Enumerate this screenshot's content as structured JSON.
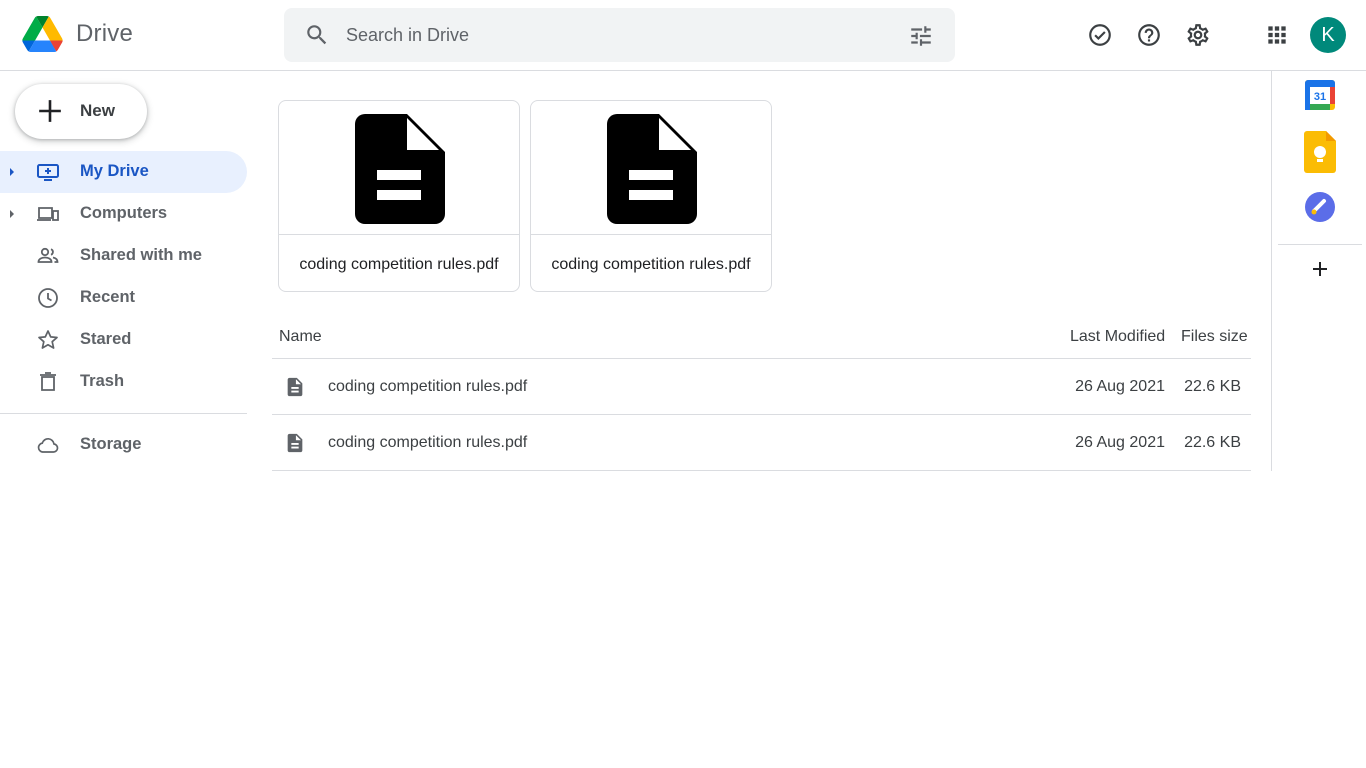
{
  "header": {
    "app_title": "Drive",
    "search_placeholder": "Search in Drive",
    "avatar_initial": "K",
    "icons": [
      "ready-for-offline-icon",
      "help-icon",
      "settings-icon",
      "apps-grid-icon"
    ]
  },
  "sidebar": {
    "new_label": "New",
    "items": [
      {
        "label": "My Drive",
        "icon": "my-drive-icon",
        "active": true,
        "expandable": true
      },
      {
        "label": "Computers",
        "icon": "computers-icon",
        "active": false,
        "expandable": true
      },
      {
        "label": "Shared with me",
        "icon": "shared-icon",
        "active": false,
        "expandable": false
      },
      {
        "label": "Recent",
        "icon": "clock-icon",
        "active": false,
        "expandable": false
      },
      {
        "label": "Stared",
        "icon": "star-icon",
        "active": false,
        "expandable": false
      },
      {
        "label": "Trash",
        "icon": "trash-icon",
        "active": false,
        "expandable": false
      }
    ],
    "storage_label": "Storage"
  },
  "suggested": [
    {
      "name": "coding competition rules.pdf"
    },
    {
      "name": "coding competition rules.pdf"
    }
  ],
  "table": {
    "columns": {
      "name": "Name",
      "modified": "Last Modified",
      "size": "Files size"
    },
    "rows": [
      {
        "name": "coding competition rules.pdf",
        "modified": "26 Aug 2021",
        "size": "22.6 KB"
      },
      {
        "name": "coding competition rules.pdf",
        "modified": "26 Aug 2021",
        "size": "22.6 KB"
      }
    ]
  },
  "side_panel": {
    "calendar_day": "31",
    "apps": [
      "calendar-app-icon",
      "keep-app-icon",
      "tasks-app-icon"
    ]
  },
  "colors": {
    "accent": "#1a56c4",
    "active_bg": "#e8f0fe",
    "avatar": "#00897b"
  }
}
